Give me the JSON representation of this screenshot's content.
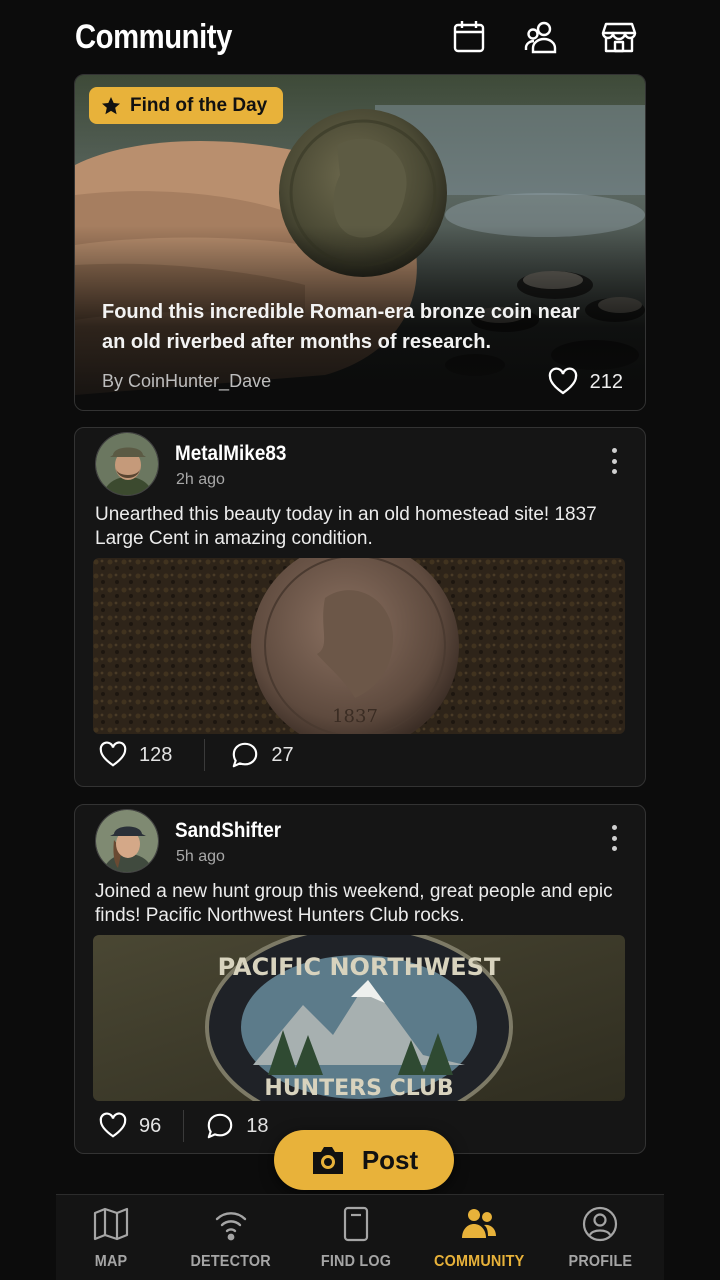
{
  "header": {
    "title": "Community",
    "icons": [
      "calendar-icon",
      "group-icon",
      "store-icon"
    ]
  },
  "featured": {
    "badge": "Find of the Day",
    "caption": "Found this incredible Roman-era bronze coin near an old riverbed after months of research.",
    "author": "By CoinHunter_Dave",
    "likes": "212"
  },
  "posts": [
    {
      "username": "MetalMike83",
      "time": "2h ago",
      "text": "Unearthed this beauty today in an old homestead site! 1837 Large Cent in amazing condition.",
      "image_text": "1837",
      "likes": "128",
      "comments": "27"
    },
    {
      "username": "SandShifter",
      "time": "5h ago",
      "text": "Joined a new hunt group this weekend, great people and epic finds! Pacific Northwest Hunters Club rocks.",
      "image_text_top": "PACIFIC NORTHWEST",
      "image_text_bottom": "HUNTERS CLUB",
      "likes": "96",
      "comments": "18"
    }
  ],
  "post_button": {
    "label": "Post"
  },
  "nav": {
    "items": [
      {
        "label": "MAP",
        "icon": "map-icon"
      },
      {
        "label": "DETECTOR",
        "icon": "detector-icon"
      },
      {
        "label": "FIND LOG",
        "icon": "find-log-icon"
      },
      {
        "label": "COMMUNITY",
        "icon": "community-icon",
        "active": true
      },
      {
        "label": "PROFILE",
        "icon": "profile-icon"
      }
    ]
  },
  "colors": {
    "accent": "#e8b23a",
    "background": "#0c0c0c",
    "card": "#151515"
  }
}
